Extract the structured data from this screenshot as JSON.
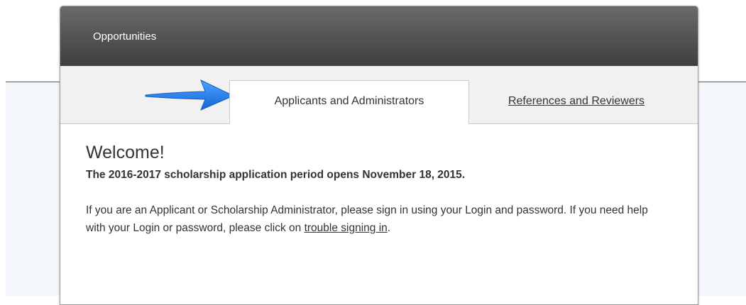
{
  "panel": {
    "title": "Opportunities"
  },
  "tabs": [
    {
      "label": "Applicants and Administrators",
      "active": true
    },
    {
      "label": "References and Reviewers",
      "active": false
    }
  ],
  "content": {
    "heading": "Welcome!",
    "notice": "The 2016-2017 scholarship application period opens November 18, 2015.",
    "body_part1": "If you are an Applicant or Scholarship Administrator, please sign in using your Login and password. If you need help with your Login or password, please click on ",
    "link_text": "trouble signing in",
    "body_part2": "."
  },
  "colors": {
    "header_dark": "#3f3f3f",
    "arrow_blue": "#1e7fe6",
    "divider_blue": "#3e5ea8"
  },
  "icons": {
    "arrow": "arrow-right-icon"
  }
}
